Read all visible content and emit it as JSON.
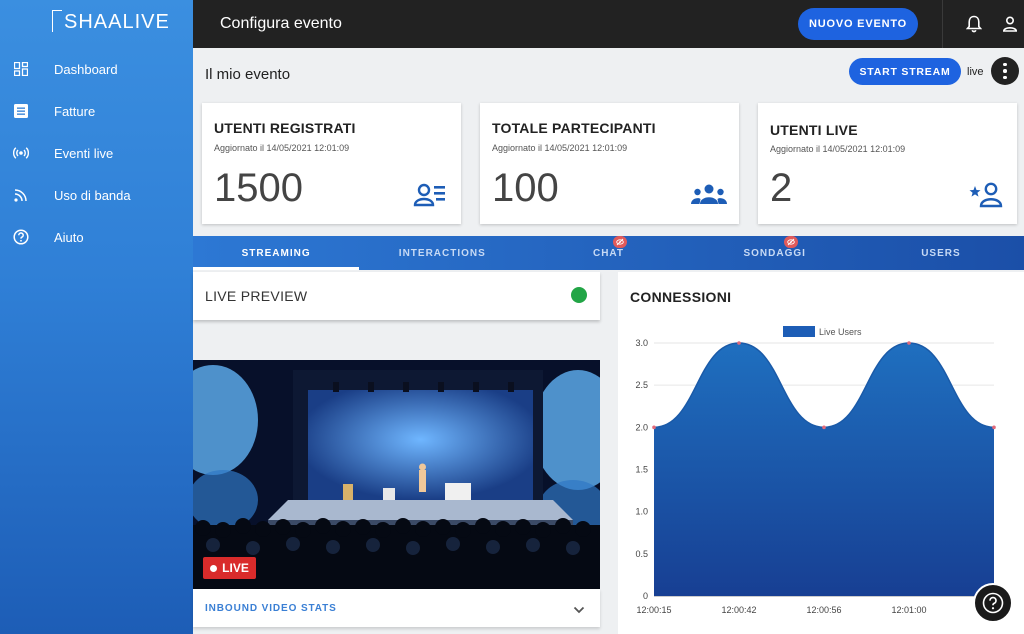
{
  "app": {
    "logo_text": "SHAALIVE"
  },
  "sidebar": {
    "items": [
      {
        "label": "Dashboard",
        "icon": "dashboard-icon"
      },
      {
        "label": "Fatture",
        "icon": "invoice-icon"
      },
      {
        "label": "Eventi live",
        "icon": "broadcast-icon"
      },
      {
        "label": "Uso di banda",
        "icon": "bandwidth-icon"
      },
      {
        "label": "Aiuto",
        "icon": "help-circle-icon"
      }
    ]
  },
  "topbar": {
    "title": "Configura evento",
    "new_event_label": "NUOVO EVENTO",
    "icons": [
      "bell-icon",
      "user-icon"
    ]
  },
  "event": {
    "title": "Il mio evento",
    "start_stream_label": "START STREAM",
    "status_text": "live"
  },
  "cards": [
    {
      "title": "UTENTI REGISTRATI",
      "updated": "Aggiornato il 14/05/2021 12:01:09",
      "value": "1500",
      "icon": "user-list-icon"
    },
    {
      "title": "TOTALE PARTECIPANTI",
      "updated": "Aggiornato il 14/05/2021 12:01:09",
      "value": "100",
      "icon": "group-icon"
    },
    {
      "title": "UTENTI LIVE",
      "updated": "Aggiornato il 14/05/2021 12:01:09",
      "value": "2",
      "icon": "star-user-icon"
    }
  ],
  "tabs": [
    {
      "label": "STREAMING",
      "active": true
    },
    {
      "label": "INTERACTIONS",
      "active": false
    },
    {
      "label": "CHAT",
      "active": false,
      "badge": "eye-off-icon"
    },
    {
      "label": "SONDAGGI",
      "active": false,
      "badge": "eye-off-icon"
    },
    {
      "label": "USERS",
      "active": false
    }
  ],
  "preview": {
    "title": "LIVE PREVIEW",
    "status_color": "#22a546",
    "live_badge": "LIVE",
    "inbound_label": "INBOUND VIDEO STATS"
  },
  "connections": {
    "title": "CONNESSIONI"
  },
  "chart_data": {
    "type": "area",
    "title": "CONNESSIONI",
    "series": [
      {
        "name": "Live Users",
        "values": [
          2,
          3,
          2,
          3,
          2
        ]
      }
    ],
    "x": [
      "12:00:15",
      "12:00:42",
      "12:00:56",
      "12:01:00",
      ""
    ],
    "ylim": [
      0,
      3.0
    ],
    "yticks": [
      "0",
      "0.5",
      "1.0",
      "1.5",
      "2.0",
      "2.5",
      "3.0"
    ],
    "legend": "top-center",
    "color": "#1d5db6"
  }
}
